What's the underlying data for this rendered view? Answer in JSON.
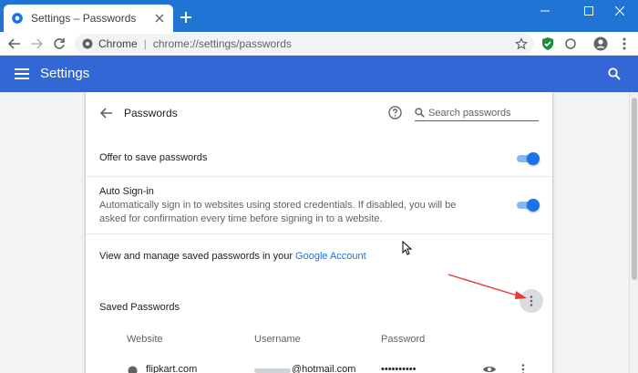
{
  "browser": {
    "tab": {
      "title": "Settings – Passwords"
    },
    "omnibox": {
      "chip": "Chrome",
      "separator": "|",
      "url": "chrome://settings/passwords"
    }
  },
  "colors": {
    "tabstrip": "#1f74d4",
    "header": "#3367d6",
    "accent": "#1a73e8",
    "toggle_track": "#8ab4f8"
  },
  "header": {
    "title": "Settings"
  },
  "passwords": {
    "title": "Passwords",
    "search_placeholder": "Search passwords",
    "offer_label": "Offer to save passwords",
    "offer_enabled": true,
    "autosignin_label": "Auto Sign-in",
    "autosignin_desc": "Automatically sign in to websites using stored credentials. If disabled, you will be asked for confirmation every time before signing in to a website.",
    "autosignin_enabled": true,
    "manage_text": "View and manage saved passwords in your",
    "manage_link": "Google Account",
    "saved_heading": "Saved Passwords",
    "columns": {
      "website": "Website",
      "username": "Username",
      "password": "Password"
    },
    "rows": [
      {
        "website": "flipkart.com",
        "username": "@hotmail.com",
        "password": "••••••••••"
      }
    ]
  },
  "icons": [
    "settings-favicon",
    "close-icon",
    "new-tab-icon",
    "minimize-icon",
    "maximize-icon",
    "window-close-icon",
    "back-icon",
    "forward-icon",
    "reload-icon",
    "site-info-icon",
    "star-icon",
    "extension-icon",
    "profile-icon",
    "menu-icon",
    "search-icon",
    "help-icon",
    "more-actions-icon",
    "globe-icon",
    "eye-icon",
    "cursor-icon"
  ]
}
